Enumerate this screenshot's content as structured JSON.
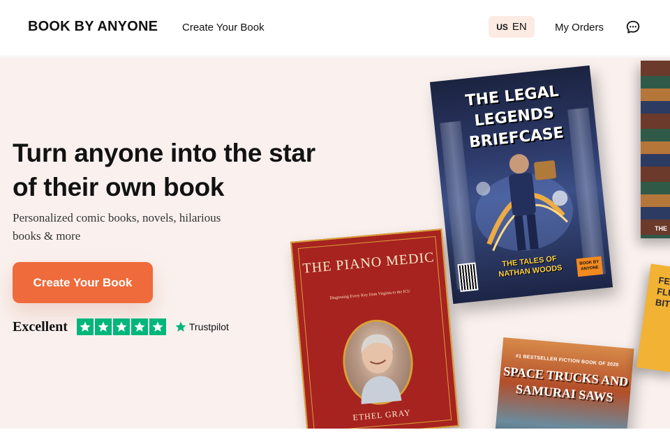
{
  "header": {
    "logo": "BOOK BY ANYONE",
    "nav_create": "Create Your Book",
    "lang_country": "US",
    "lang_code": "EN",
    "my_orders": "My Orders",
    "chat_icon": "chat-bubble-icon"
  },
  "hero": {
    "headline": "Turn anyone into the star of their own book",
    "subline": "Personalized comic books, novels, hilarious books & more",
    "cta": "Create Your Book",
    "rating_label": "Excellent",
    "rating_stars": 5,
    "trustpilot": "Trustpilot"
  },
  "books": {
    "legal": {
      "title": "THE LEGAL LEGENDS BRIEFCASE",
      "footer": "THE TALES OF NATHAN WOODS",
      "badge": "BOOK BY ANYONE"
    },
    "piano": {
      "title": "THE PIANO MEDIC",
      "subtitle": "Diagnosing Every Key from Virginia to the ICU",
      "author": "ETHEL GRAY"
    },
    "space": {
      "top": "#1 BESTSELLER FICTION BOOK OF 2026",
      "title": "SPACE TRUCKS AND SAMURAI SAWS"
    },
    "yellow": {
      "title": "FEL FLU BIT"
    },
    "stack": {
      "label": "THE"
    }
  },
  "colors": {
    "accent": "#ef6b3b",
    "hero_bg": "#faf1ee",
    "lang_bg": "#fcebe3",
    "trustpilot_green": "#00b67a"
  }
}
